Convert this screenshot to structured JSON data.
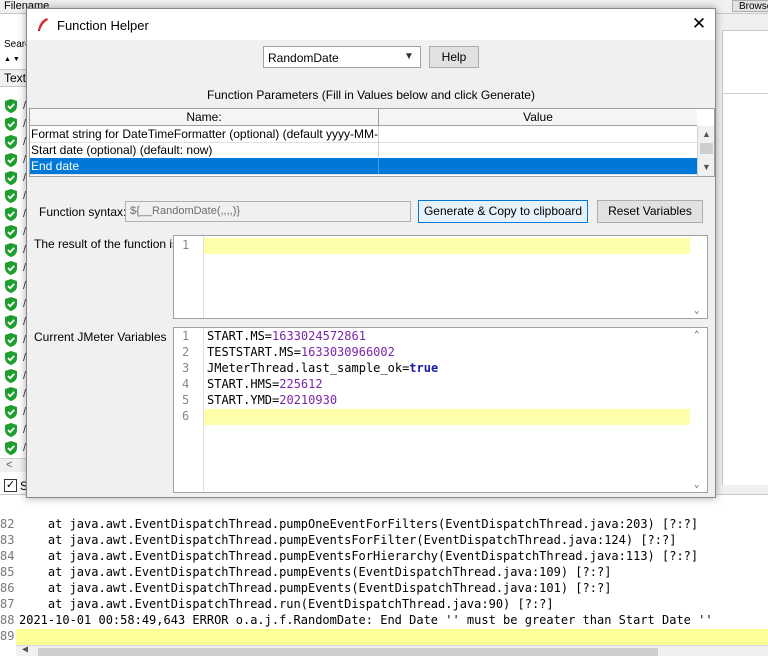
{
  "background": {
    "filename_label": "Filename",
    "browse_label": "Browse",
    "search_label": "Search",
    "sort_arrows": "▲▼",
    "text_header": "Text",
    "shield_count": 20,
    "shield_row_letter": "/",
    "checkbox_mark": "✓",
    "checkbox_label": "S"
  },
  "console": {
    "lines": [
      {
        "num": "82",
        "text": "    at java.awt.EventDispatchThread.pumpOneEventForFilters(EventDispatchThread.java:203) [?:?]"
      },
      {
        "num": "83",
        "text": "    at java.awt.EventDispatchThread.pumpEventsForFilter(EventDispatchThread.java:124) [?:?]"
      },
      {
        "num": "84",
        "text": "    at java.awt.EventDispatchThread.pumpEventsForHierarchy(EventDispatchThread.java:113) [?:?]"
      },
      {
        "num": "85",
        "text": "    at java.awt.EventDispatchThread.pumpEvents(EventDispatchThread.java:109) [?:?]"
      },
      {
        "num": "86",
        "text": "    at java.awt.EventDispatchThread.pumpEvents(EventDispatchThread.java:101) [?:?]"
      },
      {
        "num": "87",
        "text": "    at java.awt.EventDispatchThread.run(EventDispatchThread.java:90) [?:?]"
      },
      {
        "num": "88",
        "text": "2021-10-01 00:58:49,643 ERROR o.a.j.f.RandomDate: End Date '' must be greater than Start Date ''"
      },
      {
        "num": "89",
        "text": ""
      }
    ]
  },
  "dialog": {
    "title": "Function Helper",
    "close_glyph": "✕",
    "function_select": {
      "value": "RandomDate"
    },
    "help_label": "Help",
    "params_caption": "Function Parameters (Fill in Values below and click Generate)",
    "columns": {
      "name": "Name:",
      "value": "Value"
    },
    "params": [
      {
        "name": "Format string for DateTimeFormatter (optional) (default yyyy-MM-dd)",
        "value": ""
      },
      {
        "name": "Start date (optional) (default: now)",
        "value": ""
      },
      {
        "name": "End date",
        "value": ""
      }
    ],
    "selected_param_index": 2,
    "syntax_label": "Function syntax:",
    "syntax_value": "${__RandomDate(,,,,)}",
    "generate_label": "Generate & Copy to clipboard",
    "reset_label": "Reset Variables",
    "result_label": "The result of the function is",
    "result_lines": [
      {
        "num": "1",
        "text": ""
      }
    ],
    "vars_label": "Current JMeter Variables",
    "vars_lines": [
      {
        "num": "1",
        "key": "START.MS=",
        "value": "1633024572861",
        "type": "number"
      },
      {
        "num": "2",
        "key": "TESTSTART.MS=",
        "value": "1633030966002",
        "type": "number"
      },
      {
        "num": "3",
        "key": "JMeterThread.last_sample_ok=",
        "value": "true",
        "type": "bool"
      },
      {
        "num": "4",
        "key": "START.HMS=",
        "value": "225612",
        "type": "number"
      },
      {
        "num": "5",
        "key": "START.YMD=",
        "value": "20210930",
        "type": "number"
      },
      {
        "num": "6",
        "key": "",
        "value": "",
        "type": "empty"
      }
    ]
  },
  "colors": {
    "selection": "#0078d7",
    "current_line": "#ffffaa",
    "value_purple": "#7b25a8",
    "bool_blue": "#1a1aa6",
    "shield_green": "#1e9e2e"
  }
}
